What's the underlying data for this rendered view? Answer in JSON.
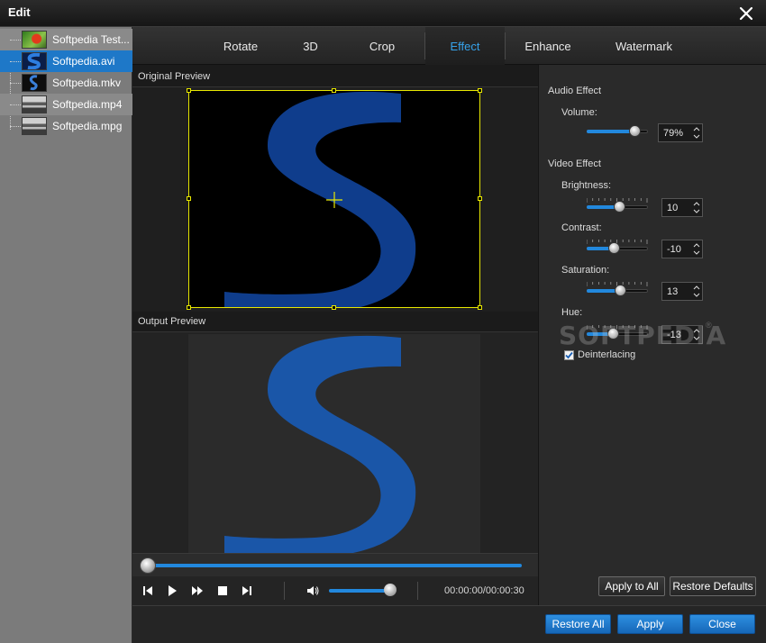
{
  "window": {
    "title": "Edit"
  },
  "files": [
    {
      "name": "Softpedia Test...",
      "thumb": "flower"
    },
    {
      "name": "Softpedia.avi",
      "thumb": "s-logo",
      "selected": true
    },
    {
      "name": "Softpedia.mkv",
      "thumb": "s-logo-small"
    },
    {
      "name": "Softpedia.mp4",
      "thumb": "street"
    },
    {
      "name": "Softpedia.mpg",
      "thumb": "street"
    }
  ],
  "tabs": [
    {
      "label": "Rotate"
    },
    {
      "label": "3D"
    },
    {
      "label": "Crop"
    },
    {
      "label": "Effect",
      "active": true
    },
    {
      "label": "Enhance"
    },
    {
      "label": "Watermark"
    }
  ],
  "preview": {
    "original_label": "Original Preview",
    "output_label": "Output Preview"
  },
  "playback": {
    "timecode": "00:00:00/00:00:30",
    "progress": 0.0,
    "volume_level": 0.95
  },
  "settings": {
    "audio_group": "Audio Effect",
    "volume": {
      "label": "Volume:",
      "value": "79%",
      "level": 0.79
    },
    "video_group": "Video Effect",
    "brightness": {
      "label": "Brightness:",
      "value": "10",
      "level": 0.55
    },
    "contrast": {
      "label": "Contrast:",
      "value": "-10",
      "level": 0.45
    },
    "saturation": {
      "label": "Saturation:",
      "value": "13",
      "level": 0.56
    },
    "hue": {
      "label": "Hue:",
      "value": "-13",
      "level": 0.44
    },
    "deinterlacing": {
      "label": "Deinterlacing",
      "checked": true
    },
    "watermark_text": "SOFTPEDIA",
    "apply_all_label": "Apply to All",
    "restore_defaults_label": "Restore Defaults"
  },
  "footer": {
    "restore_all_label": "Restore All",
    "apply_label": "Apply",
    "close_label": "Close"
  },
  "colors": {
    "accent": "#2288dd",
    "active_tab": "#36a2ea",
    "crop_frame": "#e8e800",
    "logo_blue": "#1a56a8"
  }
}
